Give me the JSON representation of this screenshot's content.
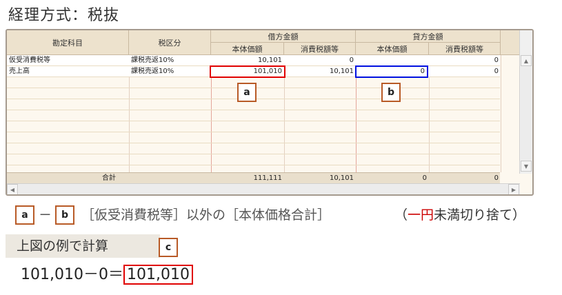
{
  "title": "経理方式：税抜",
  "grid": {
    "headers": {
      "account": "勘定科目",
      "tax_class": "税区分",
      "debit": "借方金額",
      "credit": "貸方金額",
      "debit_base": "本体価額",
      "debit_tax": "消費税額等",
      "credit_base": "本体価額",
      "credit_tax": "消費税額等"
    },
    "rows": [
      {
        "account": "仮受消費税等",
        "tax_class": "課税売返10%",
        "debit_base": "10,101",
        "debit_tax": "0",
        "credit_base": "",
        "credit_tax": "0"
      },
      {
        "account": "売上高",
        "tax_class": "課税売返10%",
        "debit_base": "101,010",
        "debit_tax": "10,101",
        "credit_base": "0",
        "credit_tax": "0"
      }
    ],
    "total": {
      "label": "合計",
      "debit_base": "111,111",
      "debit_tax": "10,101",
      "credit_base": "0",
      "credit_tax": "0"
    }
  },
  "badges": {
    "a": "a",
    "b": "b",
    "c": "c"
  },
  "formula": {
    "minus": "－",
    "description": "［仮受消費税等］以外の［本体価格合計］",
    "note_open": "（",
    "note_red": "一円",
    "note_rest": "未満切り捨て）"
  },
  "calc": {
    "heading": "上図の例で計算",
    "expression": "101,010－0＝",
    "result": "101,010"
  },
  "colors": {
    "highlight_red": "#e00000",
    "highlight_blue": "#0010e0",
    "badge_border": "#b85a26",
    "note_red": "#cc0000"
  }
}
